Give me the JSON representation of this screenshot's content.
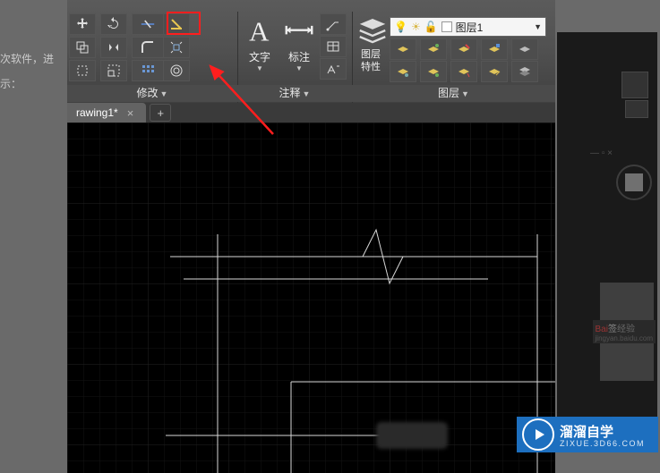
{
  "article": {
    "line1": "次软件，进",
    "line2": "示："
  },
  "ribbon": {
    "panels": {
      "modify": {
        "title": "修改"
      },
      "annotate": {
        "title": "注释"
      },
      "layers": {
        "title": "图层"
      }
    },
    "text_button": "文字",
    "dim_button": "标注",
    "layer_props_button": "图层\n特性",
    "layer_dropdown": "图层1"
  },
  "tabs": {
    "active": "rawing1*"
  },
  "watermark": {
    "baidu": "Bai",
    "baidu2": "经验"
  },
  "brand": {
    "title": "溜溜自学",
    "subtitle": "ZIXUE.3D66.COM"
  }
}
